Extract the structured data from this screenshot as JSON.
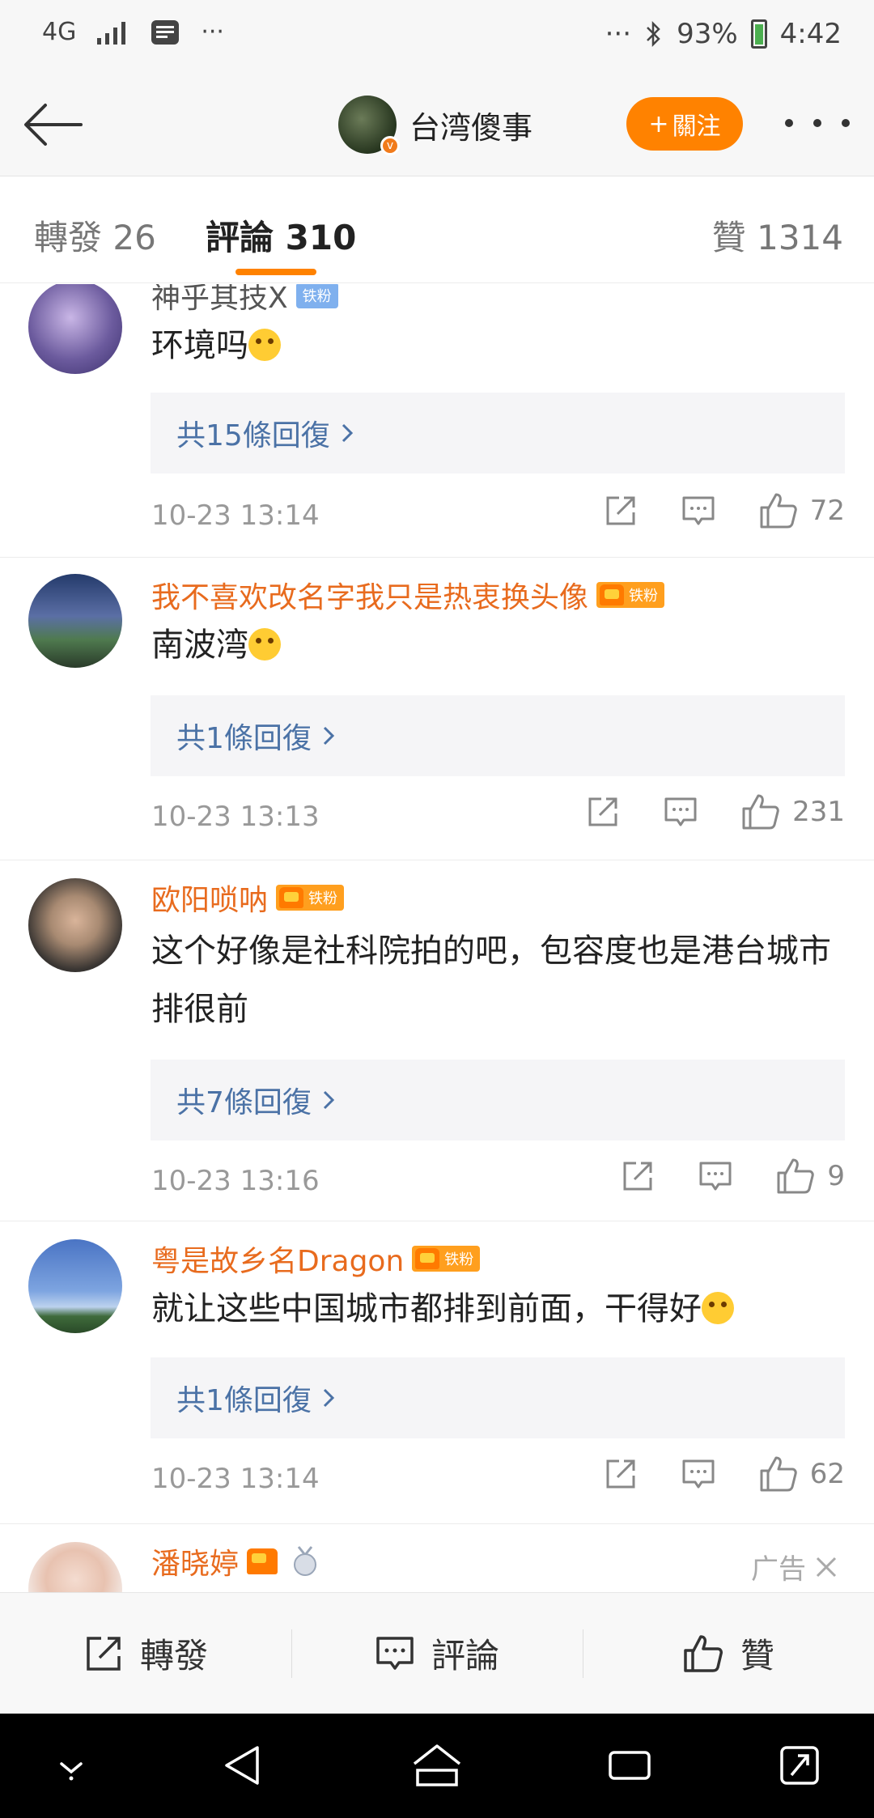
{
  "status_bar": {
    "network": "4G",
    "dots_left": "···",
    "dots_right": "···",
    "battery": "93%",
    "time": "4:42"
  },
  "header": {
    "title": "台湾傻事",
    "follow_label": "關注",
    "follow_plus": "+"
  },
  "tabs": [
    {
      "label": "轉發 26"
    },
    {
      "label": "評論 310"
    },
    {
      "label": "贊 1314"
    }
  ],
  "comments": [
    {
      "username": "神乎其技X",
      "badge": "铁粉",
      "text": "环境吗",
      "replies": "共15條回復",
      "time": "10-23 13:14",
      "likes": "72"
    },
    {
      "username": "我不喜欢改名字我只是热衷换头像",
      "badge": "铁粉",
      "text": "南波湾",
      "replies": "共1條回復",
      "time": "10-23 13:13",
      "likes": "231"
    },
    {
      "username": "欧阳唢呐",
      "badge": "铁粉",
      "text": "这个好像是社科院拍的吧，包容度也是港台城市排很前",
      "replies": "共7條回復",
      "time": "10-23 13:16",
      "likes": "9"
    },
    {
      "username": "粤是故乡名Dragon",
      "badge": "铁粉",
      "text": "就让这些中国城市都排到前面，干得好",
      "replies": "共1條回復",
      "time": "10-23 13:14",
      "likes": "62"
    },
    {
      "username": "潘晓婷",
      "ad_label": "广告"
    }
  ],
  "bottom_bar": {
    "repost": "轉發",
    "comment": "評論",
    "like": "贊"
  },
  "colors": {
    "accent": "#ff8200",
    "link": "#4b72a6",
    "username_highlight": "#e86b1e"
  }
}
